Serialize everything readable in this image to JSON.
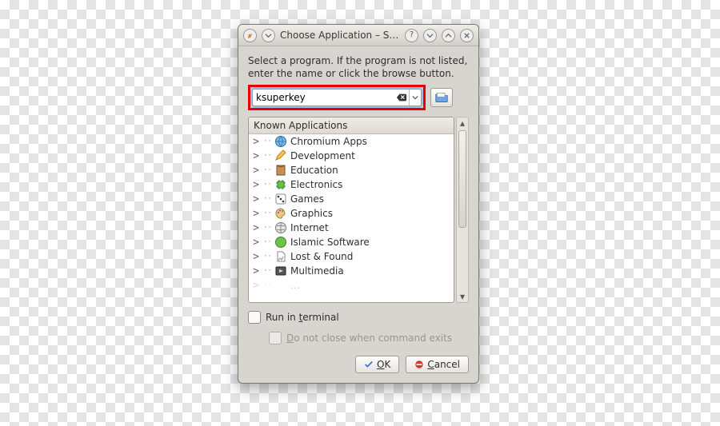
{
  "window": {
    "title": "Choose Application – S…",
    "instructions": "Select a program. If the program is not listed, enter the name or click the browse button."
  },
  "input": {
    "value": "ksuperkey",
    "placeholder": ""
  },
  "tree": {
    "header": "Known Applications",
    "items": [
      {
        "label": "Chromium Apps",
        "icon": "globe"
      },
      {
        "label": "Development",
        "icon": "pencil"
      },
      {
        "label": "Education",
        "icon": "book"
      },
      {
        "label": "Electronics",
        "icon": "chip"
      },
      {
        "label": "Games",
        "icon": "die"
      },
      {
        "label": "Graphics",
        "icon": "palette"
      },
      {
        "label": "Internet",
        "icon": "globe2"
      },
      {
        "label": "Islamic Software",
        "icon": "green"
      },
      {
        "label": "Lost & Found",
        "icon": "file"
      },
      {
        "label": "Multimedia",
        "icon": "media"
      }
    ]
  },
  "checks": {
    "run_in_terminal": "Run in terminal",
    "do_not_close": "Do not close when command exits"
  },
  "buttons": {
    "ok": "OK",
    "cancel": "Cancel"
  }
}
